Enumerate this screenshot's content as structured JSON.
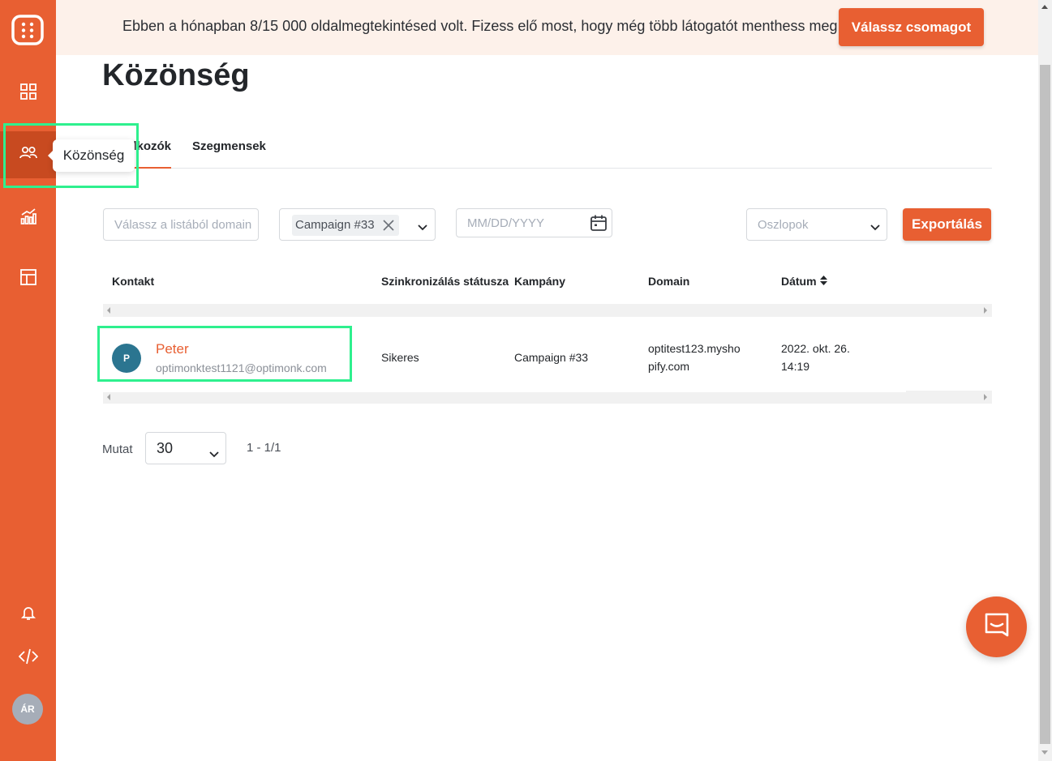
{
  "banner": {
    "message": "Ebben a hónapban 8/15 000 oldalmegtekintésed volt. Fizess elő most, hogy még több látogatót menthess meg!",
    "cta_label": "Válassz csomagot"
  },
  "sidebar": {
    "items": [
      {
        "icon": "dashboard-icon"
      },
      {
        "icon": "audience-icon",
        "active": true
      },
      {
        "icon": "analytics-icon"
      },
      {
        "icon": "templates-icon"
      },
      {
        "icon": "notification-bell-icon"
      },
      {
        "icon": "code-icon"
      }
    ],
    "tooltip": "Közönség",
    "user_initials": "ÁR"
  },
  "page": {
    "title": "Közönség",
    "tabs": [
      {
        "label": "Feliratkozók",
        "visible_label": "lkozók",
        "active": true
      },
      {
        "label": "Szegmensek",
        "active": false
      }
    ]
  },
  "filters": {
    "domain_placeholder": "Válassz a listából domain",
    "campaign_chip": "Campaign #33",
    "date_placeholder": "MM/DD/YYYY",
    "columns_placeholder": "Oszlopok",
    "export_label": "Exportálás"
  },
  "table": {
    "headers": [
      "Kontakt",
      "Szinkronizálás státusza",
      "Kampány",
      "Domain",
      "Dátum"
    ],
    "rows": [
      {
        "avatar": "P",
        "name": "Peter",
        "email": "optimonktest1121@optimonk.com",
        "sync_status": "Sikeres",
        "campaign": "Campaign #33",
        "domain_line1": "optitest123.mysho",
        "domain_line2": "pify.com",
        "date_line1": "2022. okt. 26.",
        "date_line2": "14:19"
      }
    ]
  },
  "pagination": {
    "label": "Mutat",
    "per_page": "30",
    "range": "1 - 1/1"
  },
  "colors": {
    "accent": "#e85f32",
    "sidebar_active": "#c84a20",
    "banner_bg": "#fdf1ea",
    "highlight": "#2ef08e",
    "avatar_bg": "#2b7590"
  }
}
